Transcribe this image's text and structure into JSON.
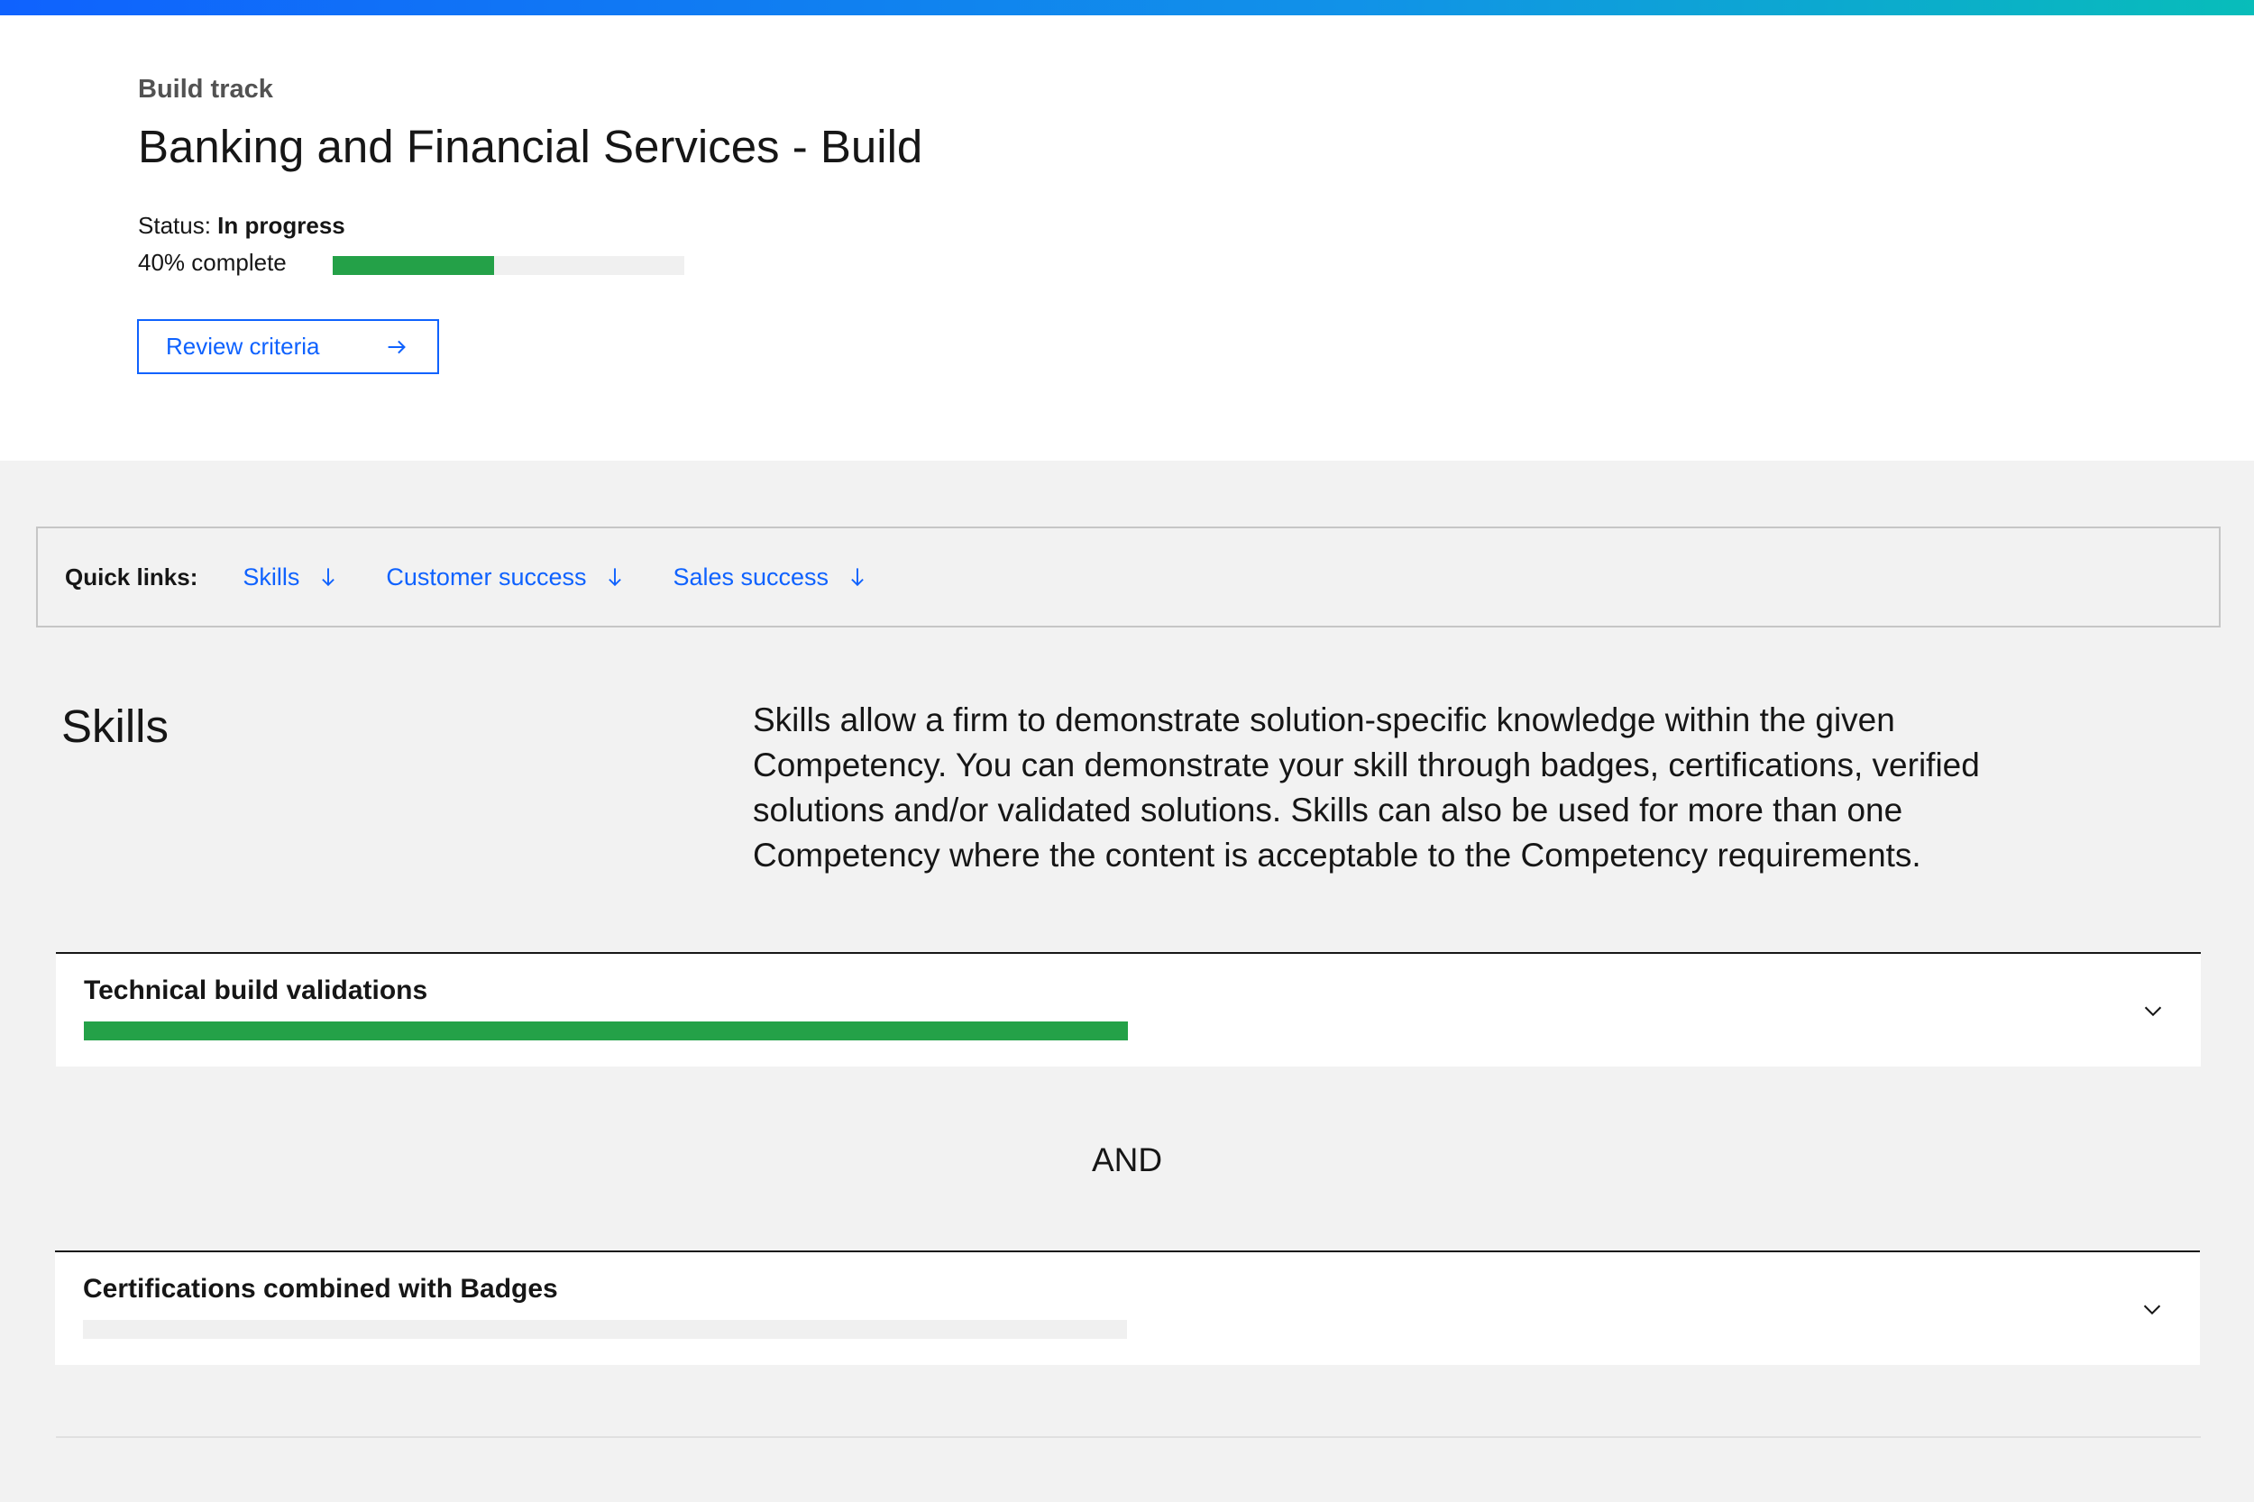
{
  "header": {
    "eyebrow": "Build track",
    "title": "Banking and Financial Services - Build",
    "status_label": "Status:",
    "status_value": "In progress",
    "complete_text": "40% complete",
    "progress_percent": 46,
    "review_button_label": "Review criteria"
  },
  "quick_links": {
    "label": "Quick links:",
    "items": [
      {
        "label": "Skills"
      },
      {
        "label": "Customer success"
      },
      {
        "label": "Sales success"
      }
    ]
  },
  "skills": {
    "title": "Skills",
    "description": "Skills allow a firm to demonstrate solution-specific knowledge within the given Competency. You can demonstrate your skill through badges, certifications, verified solutions and/or validated solutions. Skills can also be used for more than one Competency where the content is acceptable to the Competency requirements.",
    "accordions": [
      {
        "title": "Technical build validations",
        "progress_percent": 100
      },
      {
        "title": "Certifications combined with Badges",
        "progress_percent": 0
      }
    ],
    "connector": "AND"
  },
  "colors": {
    "accent": "#0f62fe",
    "success": "#24a148",
    "track": "#f0f0f0",
    "background": "#f2f2f2"
  },
  "icons": {
    "review_button": "arrow-right-icon",
    "quick_link": "arrow-down-icon",
    "accordion": "chevron-down-icon"
  }
}
